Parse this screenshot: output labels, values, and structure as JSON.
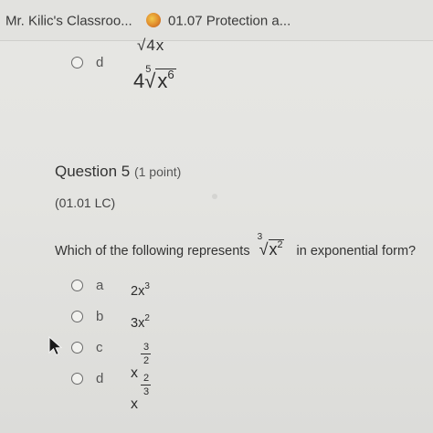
{
  "bookmarks": {
    "item1": "Mr. Kilic's Classroo...",
    "item2": "01.07 Protection a..."
  },
  "previous_question": {
    "top_fragment": "√4x",
    "option_d_letter": "d",
    "option_d_coefficient": "4",
    "option_d_root_index": "5",
    "option_d_radicand_base": "x",
    "option_d_radicand_exp": "6"
  },
  "question": {
    "title": "Question 5",
    "points": "(1 point)",
    "code": "(01.01 LC)",
    "text_before": "Which of the following represents",
    "root_index": "3",
    "radicand_base": "x",
    "radicand_exp": "2",
    "text_after": "in exponential form?"
  },
  "options": [
    {
      "letter": "a",
      "base": "2x",
      "exp": "3"
    },
    {
      "letter": "b",
      "base": "3x",
      "exp": "2"
    },
    {
      "letter": "c",
      "base": "x",
      "exp_num": "3",
      "exp_den": "2"
    },
    {
      "letter": "d",
      "base": "x",
      "exp_num": "2",
      "exp_den": "3"
    }
  ]
}
